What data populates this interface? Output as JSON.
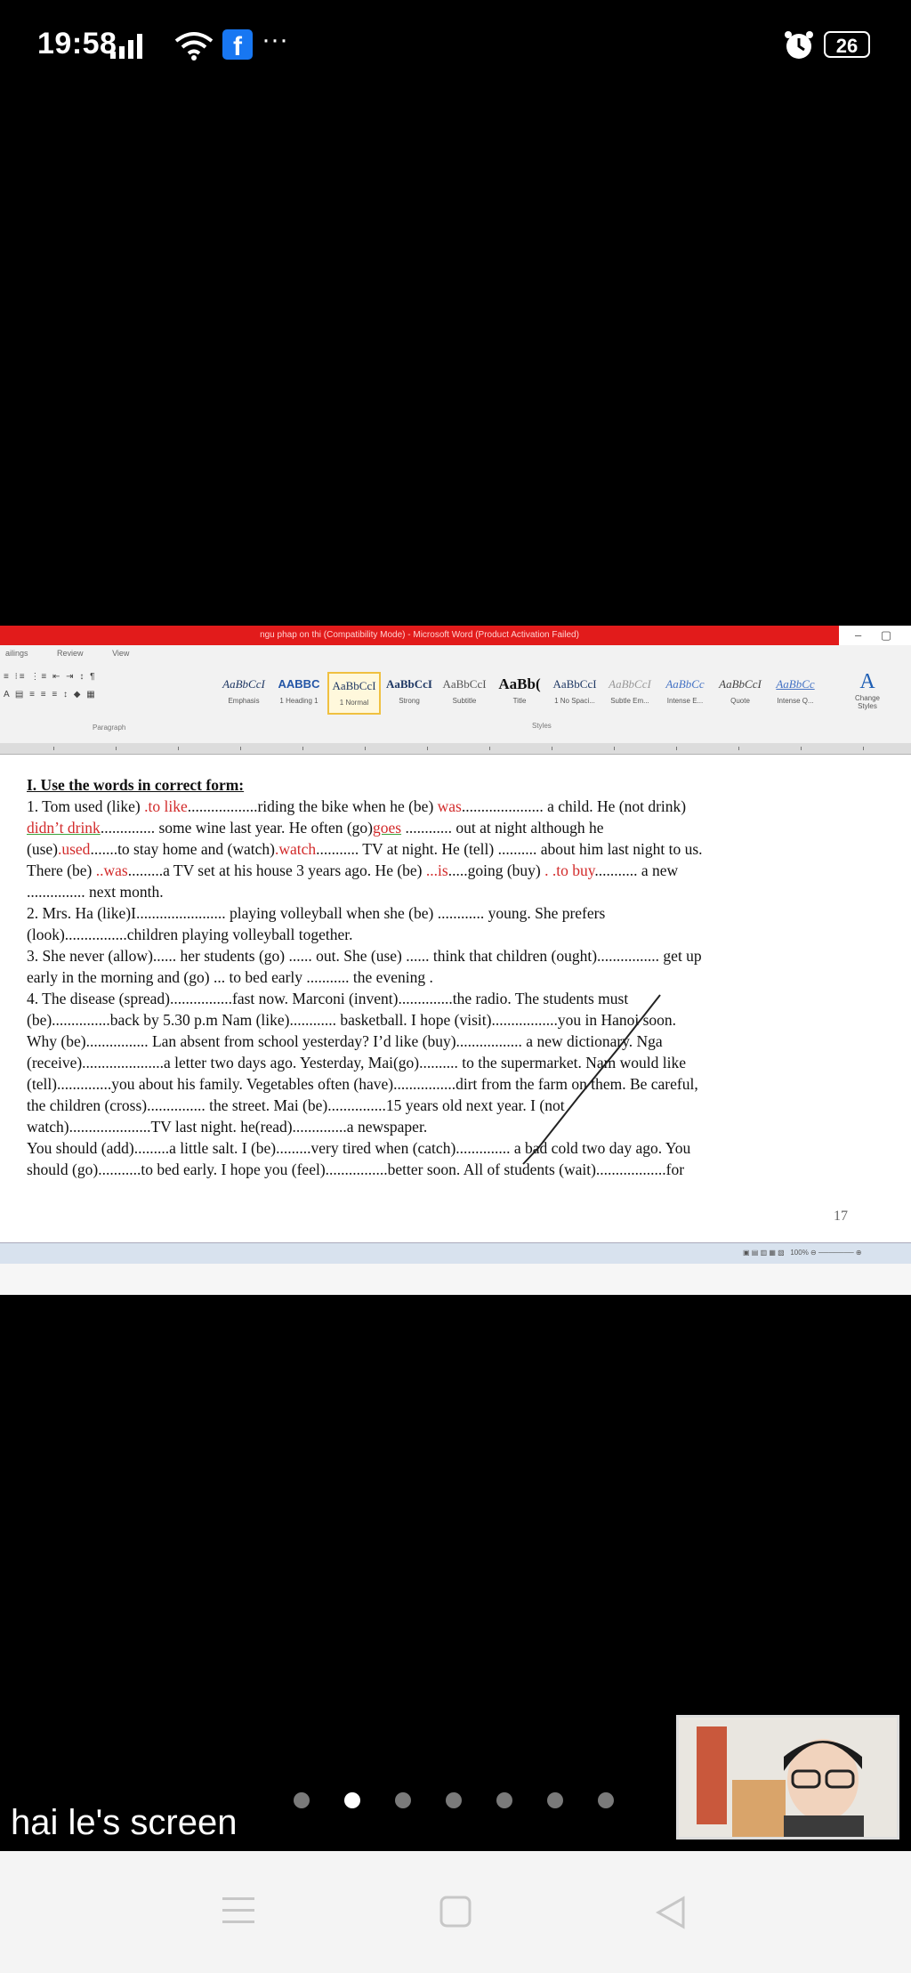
{
  "status_bar": {
    "time": "19:58",
    "battery": "26",
    "overflow": "···",
    "fb_letter": "f"
  },
  "window": {
    "title": "ngu phap on thi (Compatibility Mode) - Microsoft Word (Product Activation Failed)",
    "controls": [
      "–",
      "▢",
      "✕"
    ]
  },
  "ribbon": {
    "tabs": [
      "ailings",
      "Review",
      "View"
    ],
    "paragraph_label": "Paragraph",
    "styles_label": "Styles",
    "styles": [
      {
        "preview": "AaBbCcI",
        "name": "Emphasis"
      },
      {
        "preview": "AABBC",
        "name": "1 Heading 1"
      },
      {
        "preview": "AaBbCcI",
        "name": "1 Normal"
      },
      {
        "preview": "AaBbCcI",
        "name": "Strong"
      },
      {
        "preview": "AaBbCcI",
        "name": "Subtitle"
      },
      {
        "preview": "AaBb(",
        "name": "Title"
      },
      {
        "preview": "AaBbCcI",
        "name": "1 No Spaci..."
      },
      {
        "preview": "AaBbCcI",
        "name": "Subtle Em..."
      },
      {
        "preview": "AaBbCc",
        "name": "Intense E..."
      },
      {
        "preview": "AaBbCcI",
        "name": "Quote"
      },
      {
        "preview": "AaBbCc",
        "name": "Intense Q..."
      }
    ],
    "change_styles": "Change Styles"
  },
  "document": {
    "heading": "I. Use the words in correct form:",
    "page_number": "17",
    "ans": {
      "a1": ".to like",
      "a2": "was",
      "a3": "didn’t drink",
      "a4": "goes",
      "a5": ".used",
      "a6": ".watch",
      "a7": "..was",
      "a8": "...is",
      "a9": ". .to  buy"
    },
    "t": {
      "l1a": "1. Tom used (like) ",
      "l1b": "..................riding the bike when he (be) ",
      "l1c": "..................... a child. He (not drink)",
      "l2b": ".............. some wine last year. He often (go)",
      "l2c": " ............ out at night although he",
      "l3a": "(use)",
      "l3b": ".......to stay home and (watch)",
      "l3c": "........... TV at night. He (tell) .......... about  him last night to us.",
      "l4a": "There (be) ",
      "l4b": ".........a TV set at his house 3 years ago. He (be) ",
      "l4c": ".....going (buy) ",
      "l4d": "........... a new",
      "l5": "............... next month.",
      "l6": "2. Mrs. Ha (like)I....................... playing volleyball when she (be) ............ young. She prefers",
      "l7": "(look)................children playing volleyball together.",
      "l8": "3. She never (allow)...... her students (go) ...... out. She (use) ...... think that children  (ought)................ get up",
      "l9": "early in the morning and (go) ... to bed early ........... the evening .",
      "l10": "4. The disease (spread)................fast now. Marconi (invent)..............the radio. The students must",
      "l11": "(be)...............back by 5.30 p.m Nam (like)............ basketball. I hope (visit).................you in Hanoi soon.",
      "l12": "Why (be)................ Lan absent from school yesterday? I’d like (buy)................. a new dictionary.  Nga",
      "l13": "(receive).....................a letter two days ago. Yesterday, Mai(go).......... to the supermarket. Nam would like",
      "l14": "(tell)..............you about his family. Vegetables often (have)................dirt from the farm on them. Be careful,",
      "l15": "the children (cross)............... the street. Mai (be)...............15 years old next year. I (not",
      "l16": "watch).....................TV last night. he(read)..............a newspaper.",
      "l17": "You should (add).........a little salt. I (be).........very tired when (catch).............. a bad cold two day ago. You",
      "l18": "should (go)...........to bed early. I hope you (feel)................better soon. All of students (wait)..................for"
    }
  },
  "statusbar_word": {
    "zoom": "100%"
  },
  "meeting": {
    "screen_label": "hai le's screen",
    "page_indicator": {
      "count": 7,
      "active": 2
    }
  }
}
